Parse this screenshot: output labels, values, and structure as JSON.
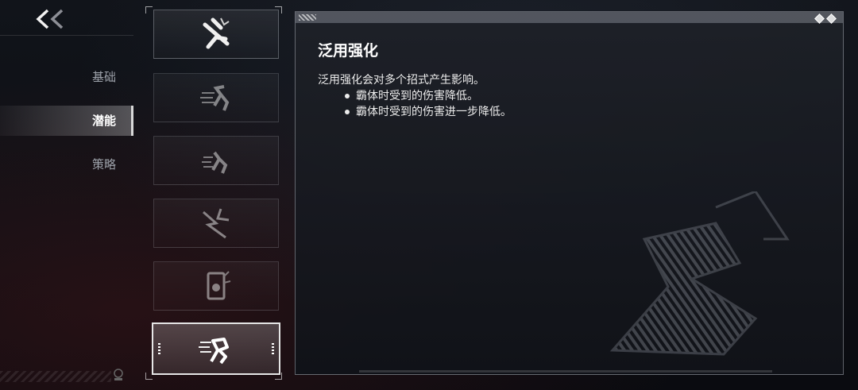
{
  "nav": {
    "back_icon": "double-chevron-left-icon"
  },
  "menu": {
    "items": [
      {
        "label": "基础",
        "active": false
      },
      {
        "label": "潜能",
        "active": true
      },
      {
        "label": "策略",
        "active": false
      }
    ]
  },
  "skills": [
    {
      "icon": "running-figure-slash-icon",
      "state": "normal"
    },
    {
      "icon": "dash-figure-icon",
      "state": "dim"
    },
    {
      "icon": "dash-figure-icon",
      "state": "dim"
    },
    {
      "icon": "lightning-burst-icon",
      "state": "dim"
    },
    {
      "icon": "badge-emblem-icon",
      "state": "dim"
    },
    {
      "icon": "armored-runner-icon",
      "state": "selected"
    }
  ],
  "detail": {
    "title": "泛用强化",
    "description": "泛用强化会对多个招式产生影响。",
    "bullets": [
      "霸体时受到的伤害降低。",
      "霸体时受到的伤害进一步降低。"
    ]
  },
  "colors": {
    "background": "#0d0f14",
    "accent": "#e6e6e6",
    "menu_text": "#9da2aa"
  }
}
